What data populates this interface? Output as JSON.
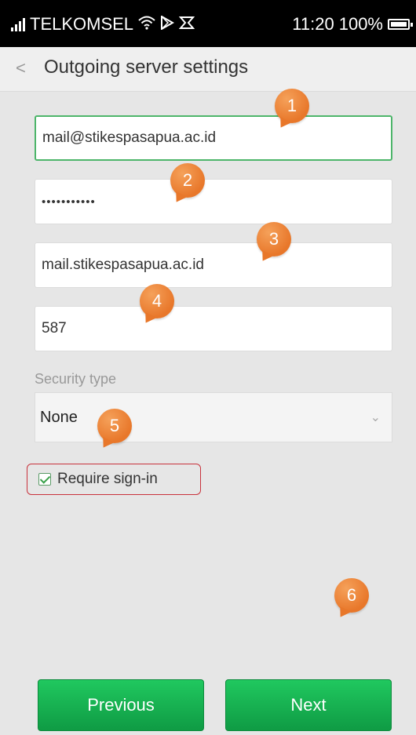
{
  "status_bar": {
    "carrier": "TELKOMSEL",
    "time": "11:20",
    "battery": "100%"
  },
  "header": {
    "back_glyph": "<",
    "title": "Outgoing server settings"
  },
  "form": {
    "email_value": "mail@stikespasapua.ac.id",
    "password_value": "•••••••••••",
    "server_value": "mail.stikespasapua.ac.id",
    "port_value": "587",
    "security_label": "Security type",
    "security_value": "None",
    "require_signin_label": "Require sign-in",
    "require_signin_checked": true
  },
  "buttons": {
    "previous_label": "Previous",
    "next_label": "Next"
  },
  "markers": [
    "1",
    "2",
    "3",
    "4",
    "5",
    "6"
  ],
  "colors": {
    "accent_green": "#1db954",
    "marker_orange": "#e8772a",
    "highlight_red": "#c8323c"
  }
}
